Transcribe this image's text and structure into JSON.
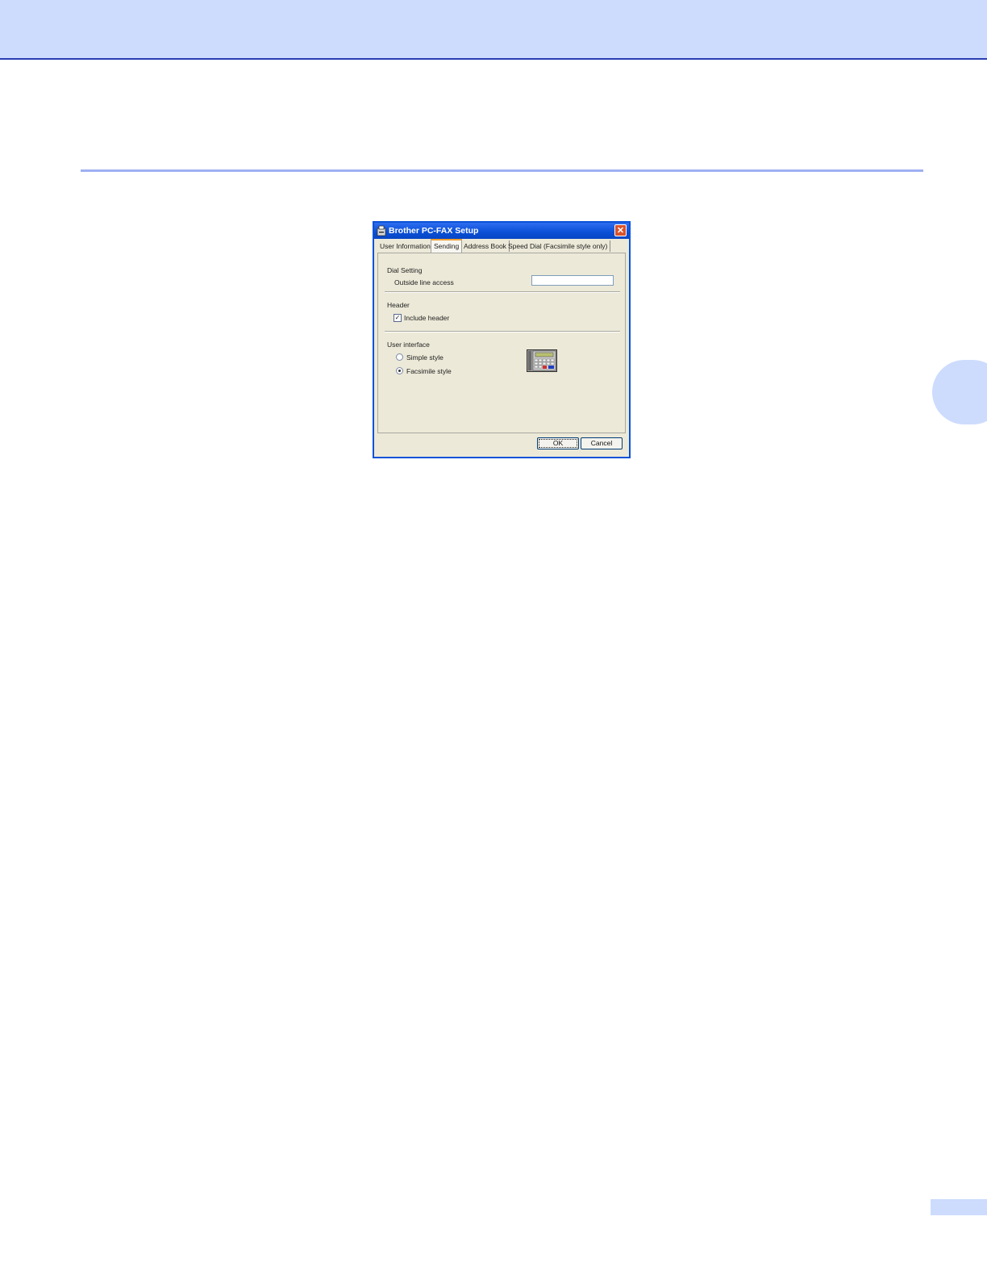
{
  "dialog": {
    "title": "Brother PC-FAX Setup",
    "close_label": "✕",
    "tabs": [
      {
        "label": "User Information"
      },
      {
        "label": "Sending"
      },
      {
        "label": "Address Book"
      },
      {
        "label": "Speed Dial (Facsimile style only)"
      }
    ],
    "active_tab": "Sending",
    "dial_setting": {
      "group_label": "Dial Setting",
      "outside_line_label": "Outside line access",
      "outside_line_value": ""
    },
    "header": {
      "group_label": "Header",
      "include_header_label": "Include header",
      "include_header_checked": true,
      "check_mark": "✓"
    },
    "user_interface": {
      "group_label": "User interface",
      "options": [
        {
          "label": "Simple style",
          "selected": false
        },
        {
          "label": "Facsimile style",
          "selected": true
        }
      ],
      "preview_icon": "fax-machine-icon"
    },
    "buttons": {
      "ok_label": "OK",
      "cancel_label": "Cancel"
    }
  },
  "colors": {
    "header_band": "#cddcfd",
    "header_rule": "#2a3fb0",
    "section_rule": "#9fb0f3",
    "titlebar": "#0a4fd6",
    "dialog_face": "#ece9d8"
  }
}
